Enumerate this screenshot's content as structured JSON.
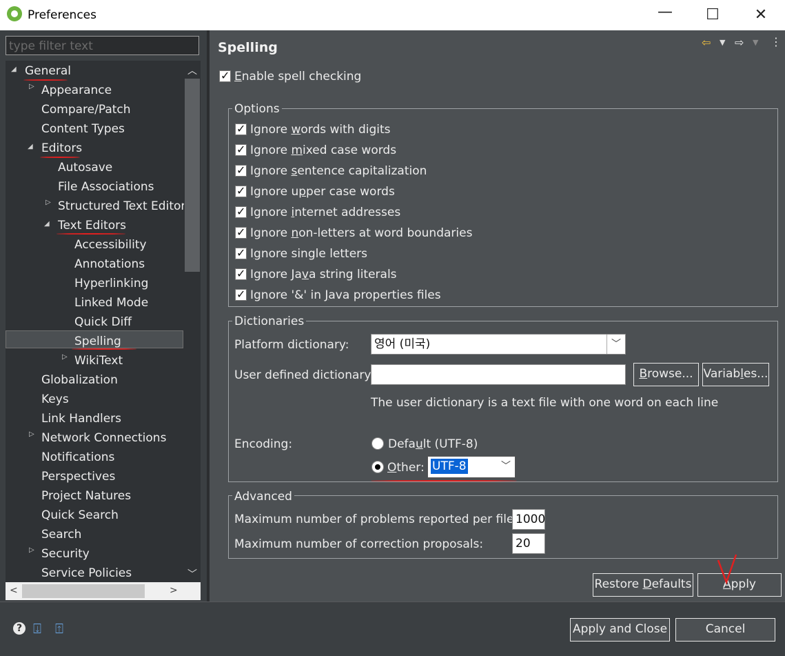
{
  "window": {
    "title": "Preferences",
    "minimize": "—",
    "maximize": "☐",
    "close": "✕"
  },
  "filter": {
    "placeholder": "type filter text"
  },
  "tree": {
    "items": [
      {
        "label": "General"
      },
      {
        "label": "Appearance"
      },
      {
        "label": "Compare/Patch"
      },
      {
        "label": "Content Types"
      },
      {
        "label": "Editors"
      },
      {
        "label": "Autosave"
      },
      {
        "label": "File Associations"
      },
      {
        "label": "Structured Text Editors"
      },
      {
        "label": "Text Editors"
      },
      {
        "label": "Accessibility"
      },
      {
        "label": "Annotations"
      },
      {
        "label": "Hyperlinking"
      },
      {
        "label": "Linked Mode"
      },
      {
        "label": "Quick Diff"
      },
      {
        "label": "Spelling"
      },
      {
        "label": "WikiText"
      },
      {
        "label": "Globalization"
      },
      {
        "label": "Keys"
      },
      {
        "label": "Link Handlers"
      },
      {
        "label": "Network Connections"
      },
      {
        "label": "Notifications"
      },
      {
        "label": "Perspectives"
      },
      {
        "label": "Project Natures"
      },
      {
        "label": "Quick Search"
      },
      {
        "label": "Search"
      },
      {
        "label": "Security"
      },
      {
        "label": "Service Policies"
      }
    ]
  },
  "page": {
    "title": "Spelling",
    "enable_spell": {
      "pre": "",
      "mn": "E",
      "post": "nable spell checking",
      "checked": true
    },
    "options": {
      "legend": "Options",
      "items": [
        {
          "pre": "Ignore ",
          "mn": "w",
          "post": "ords with digits",
          "checked": true
        },
        {
          "pre": "Ignore ",
          "mn": "m",
          "post": "ixed case words",
          "checked": true
        },
        {
          "pre": "Ignore ",
          "mn": "s",
          "post": "entence capitalization",
          "checked": true
        },
        {
          "pre": "Ignore u",
          "mn": "p",
          "post": "per case words",
          "checked": true
        },
        {
          "pre": "Ignore ",
          "mn": "i",
          "post": "nternet addresses",
          "checked": true
        },
        {
          "pre": "Ignore ",
          "mn": "n",
          "post": "on-letters at word boundaries",
          "checked": true
        },
        {
          "pre": "I",
          "mn": "g",
          "post": "nore single letters",
          "checked": true
        },
        {
          "pre": "Ignore Ja",
          "mn": "v",
          "post": "a string literals",
          "checked": true
        },
        {
          "pre": "Ignore '&' in ",
          "mn": "J",
          "post": "ava properties files",
          "checked": true
        }
      ]
    },
    "dictionaries": {
      "legend": "Dictionaries",
      "platform_label": "Platform dictionary:",
      "platform_value": "영어 (미국)",
      "user_label": "User defined dictionary:",
      "user_value": "",
      "browse": {
        "mn": "B",
        "post": "rowse..."
      },
      "variables": {
        "pre": "Variab",
        "mn": "l",
        "post": "es..."
      },
      "hint": "The user dictionary is a text file with one word on each line",
      "encoding_label": "Encoding:",
      "default_radio": {
        "pre": "Defa",
        "mn": "u",
        "post": "lt (UTF-8)",
        "selected": false
      },
      "other_radio": {
        "pre": "",
        "mn": "O",
        "post": "ther:",
        "selected": true
      },
      "other_value": "UTF-8"
    },
    "advanced": {
      "legend": "Advanced",
      "max_problems_label": "Maximum number of problems reported per file:",
      "max_problems_value": "1000",
      "max_proposals_label": "Maximum number of correction proposals:",
      "max_proposals_value": "20"
    },
    "restore_defaults": {
      "pre": "Restore ",
      "mn": "D",
      "post": "efaults"
    },
    "apply": {
      "pre": "",
      "mn": "A",
      "post": "pply"
    }
  },
  "footer": {
    "apply_close": "Apply and Close",
    "cancel": "Cancel",
    "help_icon": "?"
  },
  "colors": {
    "tree_bg": "#2f3235",
    "pane_bg": "#4c5053",
    "annotation_red": "#e02020"
  }
}
